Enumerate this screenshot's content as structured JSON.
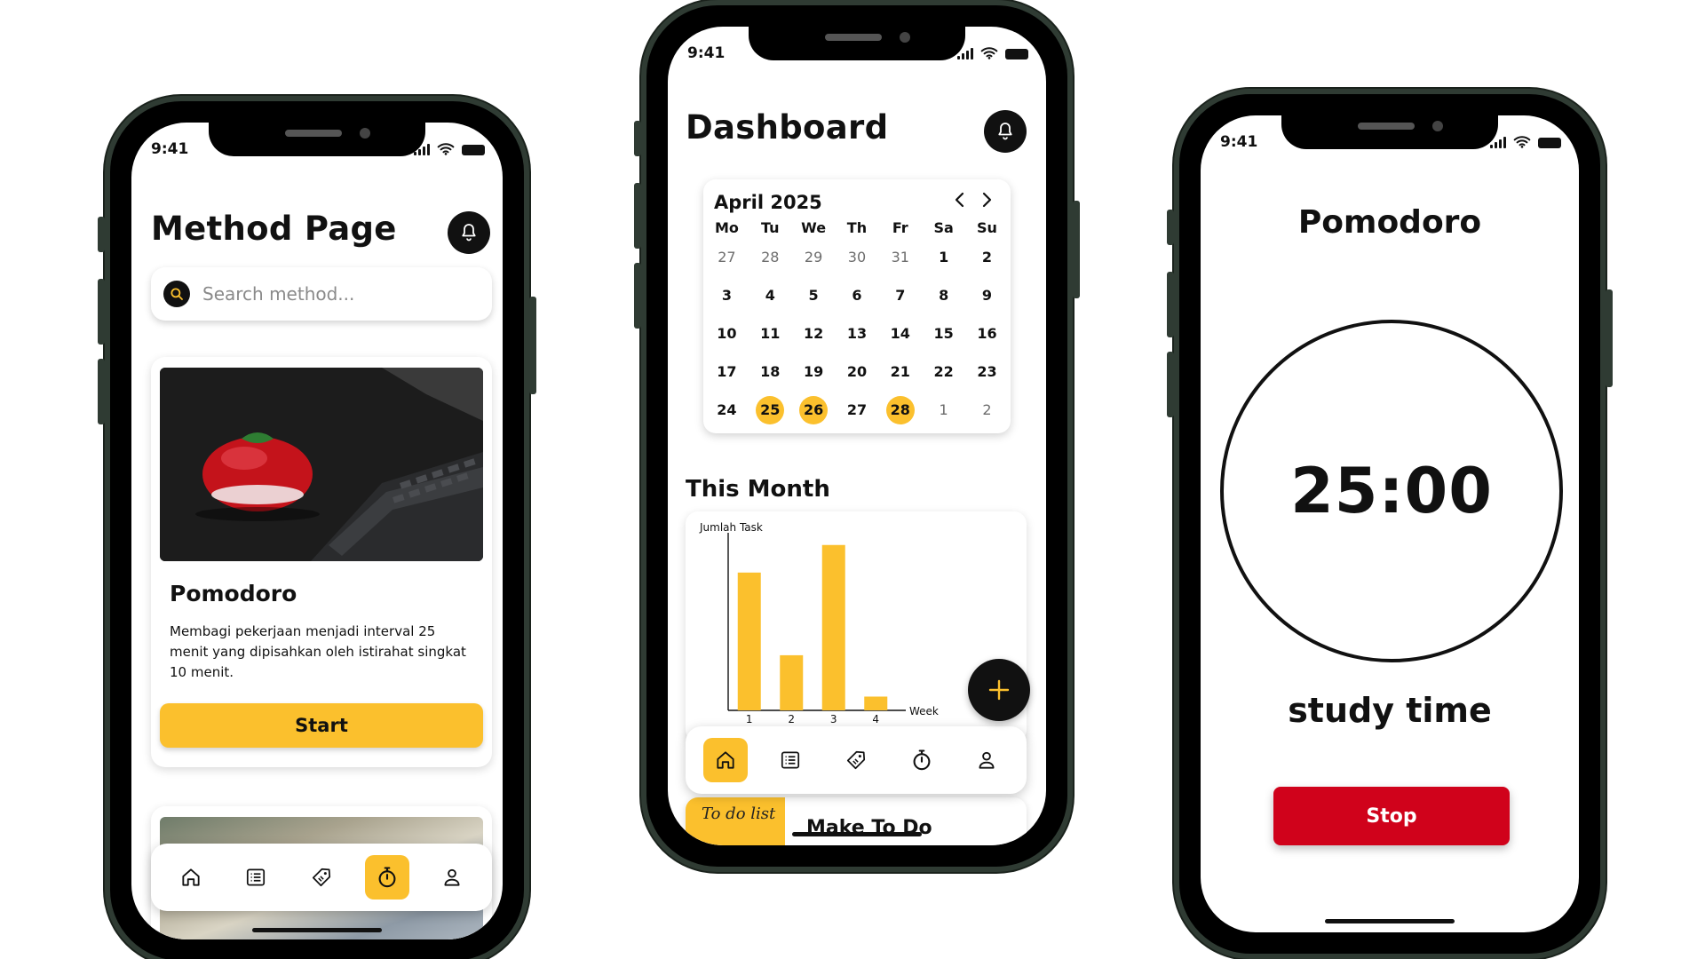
{
  "status_time": "9:41",
  "method_page": {
    "title": "Method Page",
    "search": {
      "placeholder": "Search method..."
    },
    "card": {
      "name": "Pomodoro",
      "description": "Membagi pekerjaan menjadi interval 25 menit yang dipisahkan oleh istirahat singkat 10 menit.",
      "start_label": "Start"
    },
    "tabbar": {
      "active": "timer"
    }
  },
  "dashboard": {
    "title": "Dashboard",
    "calendar": {
      "month": "April 2025",
      "weekdays": [
        "Mo",
        "Tu",
        "We",
        "Th",
        "Fr",
        "Sa",
        "Su"
      ],
      "weeks": [
        [
          "27",
          "28",
          "29",
          "30",
          "31",
          "1",
          "2"
        ],
        [
          "3",
          "4",
          "5",
          "6",
          "7",
          "8",
          "9"
        ],
        [
          "10",
          "11",
          "12",
          "13",
          "14",
          "15",
          "16"
        ],
        [
          "17",
          "18",
          "19",
          "20",
          "21",
          "22",
          "23"
        ],
        [
          "24",
          "25",
          "26",
          "27",
          "28",
          "1",
          "2"
        ]
      ],
      "highlighted_days": [
        "25",
        "26",
        "28"
      ],
      "highlight_color": "#fbc02d"
    },
    "this_month_title": "This Month",
    "chart_data": {
      "type": "bar",
      "ylabel": "Jumlah Task",
      "xlabel": "Week",
      "categories": [
        "1",
        "2",
        "3",
        "4"
      ],
      "values": [
        10,
        4,
        12,
        1
      ],
      "ylim": [
        0,
        12.5
      ],
      "color": "#fbc02d",
      "grid": false
    },
    "todo_peek": {
      "note": "To do list",
      "title": "Make To Do"
    },
    "tabbar": {
      "active": "home"
    }
  },
  "pomodoro": {
    "title": "Pomodoro",
    "timer": "25:00",
    "subtitle": "study time",
    "stop_label": "Stop",
    "stop_color": "#d0021b"
  },
  "colors": {
    "accent": "#fbc02d",
    "dark": "#111111",
    "frame": "#2f3b33"
  }
}
